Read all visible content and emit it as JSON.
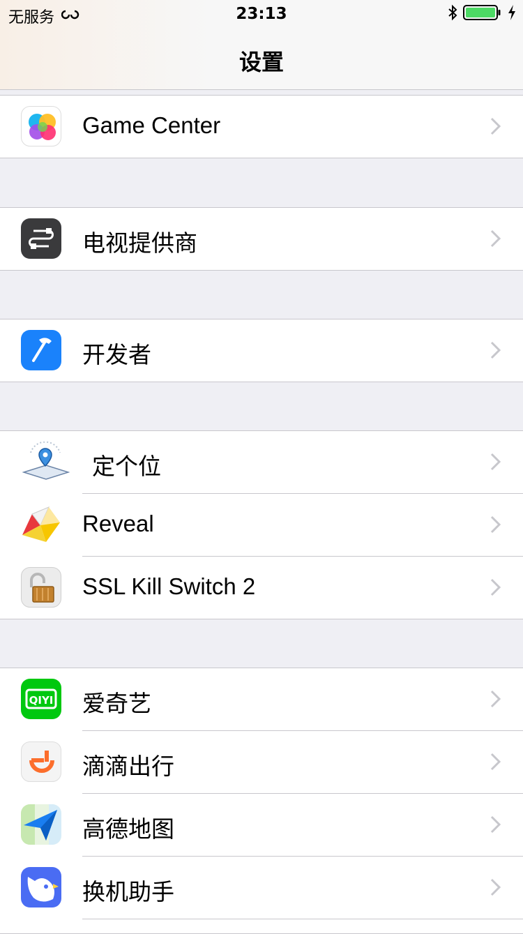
{
  "status": {
    "carrier": "无服务",
    "time": "23:13"
  },
  "nav": {
    "title": "设置"
  },
  "groups": [
    {
      "items": [
        {
          "label": "Game Center",
          "icon": "game-center-icon"
        }
      ]
    },
    {
      "items": [
        {
          "label": "电视提供商",
          "icon": "tv-provider-icon"
        }
      ]
    },
    {
      "items": [
        {
          "label": "开发者",
          "icon": "developer-hammer-icon"
        }
      ]
    },
    {
      "items": [
        {
          "label": " 定个位",
          "icon": "location-pin-icon"
        },
        {
          "label": "Reveal",
          "icon": "reveal-app-icon"
        },
        {
          "label": "SSL Kill Switch 2",
          "icon": "padlock-icon"
        }
      ]
    },
    {
      "items": [
        {
          "label": "爱奇艺",
          "icon": "iqiyi-app-icon"
        },
        {
          "label": "滴滴出行",
          "icon": "didi-app-icon"
        },
        {
          "label": "高德地图",
          "icon": "amap-navigation-icon"
        },
        {
          "label": "换机助手",
          "icon": "phone-clone-bird-icon"
        }
      ]
    }
  ],
  "colors": {
    "background": "#efeff4",
    "separator": "#c8c7cc",
    "battery": "#4cd964",
    "chevron": "#c7c7cc"
  }
}
